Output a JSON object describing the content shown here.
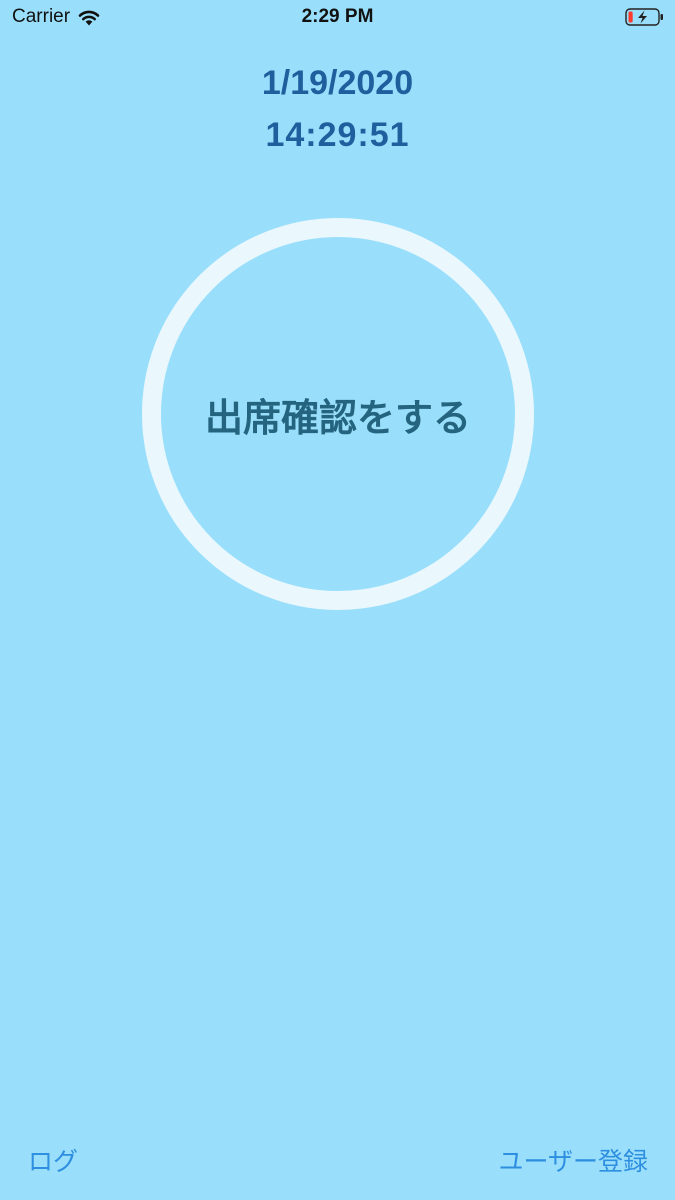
{
  "status_bar": {
    "carrier": "Carrier",
    "time": "2:29 PM",
    "icons": [
      "wifi-icon",
      "battery-charging-icon"
    ],
    "battery_level": 0.15,
    "battery_color": "#ff3b30"
  },
  "main": {
    "date": "1/19/2020",
    "time": "14:29:51",
    "checkin_label": "出席確認をする"
  },
  "footer": {
    "log_label": "ログ",
    "register_label": "ユーザー登録"
  },
  "colors": {
    "background": "#99dffb",
    "date_text": "#1f5f9e",
    "ring": "#eaf7fd",
    "button_text": "#24647f",
    "link": "#2e8ee0"
  }
}
